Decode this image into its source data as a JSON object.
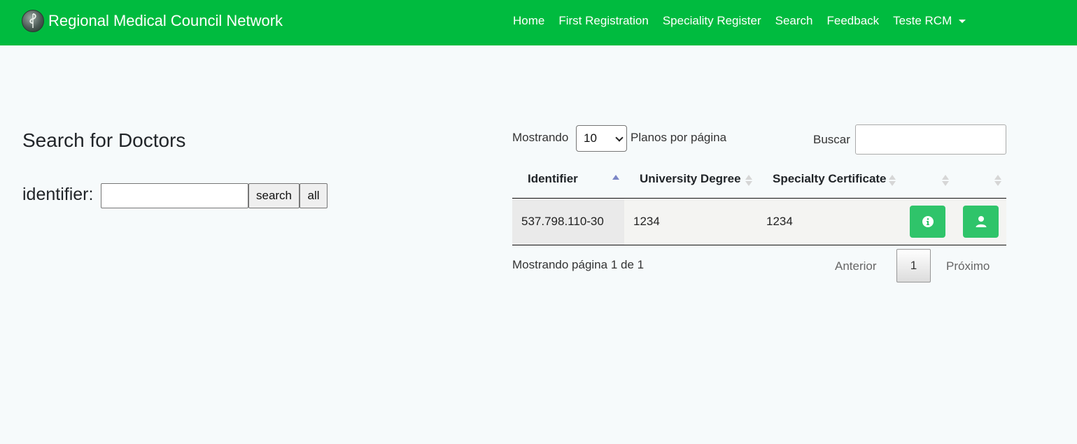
{
  "navbar": {
    "brand": "Regional Medical Council Network",
    "links": [
      "Home",
      "First Registration",
      "Speciality Register",
      "Search",
      "Feedback"
    ],
    "user_menu": "Teste RCM"
  },
  "search_panel": {
    "title": "Search for Doctors",
    "identifier_label": "identifier:",
    "identifier_value": "",
    "search_button": "search",
    "all_button": "all"
  },
  "table_controls": {
    "length_prefix": "Mostrando",
    "length_value": "10",
    "length_suffix": "Planos por página",
    "search_label": "Buscar",
    "search_value": ""
  },
  "table": {
    "columns": [
      "Identifier",
      "University Degree",
      "Specialty Certificate",
      "",
      ""
    ],
    "sorted_column": "Identifier",
    "rows": [
      {
        "identifier": "537.798.110-30",
        "university_degree": "1234",
        "specialty_certificate": "1234"
      }
    ],
    "action_icons": [
      "info-circle-icon",
      "user-icon"
    ]
  },
  "pagination": {
    "info": "Mostrando página 1 de 1",
    "previous": "Anterior",
    "current_page": "1",
    "next": "Próximo"
  },
  "colors": {
    "navbar": "#00bb3f",
    "action_button": "#2fc46a",
    "background": "#f6fafb"
  }
}
